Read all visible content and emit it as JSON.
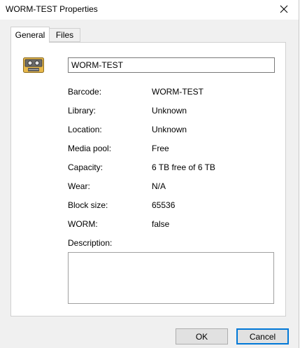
{
  "window": {
    "title": "WORM-TEST Properties"
  },
  "tabs": [
    {
      "label": "General",
      "selected": true
    },
    {
      "label": "Files",
      "selected": false
    }
  ],
  "general": {
    "icon": "tape-cartridge-icon",
    "name_value": "WORM-TEST",
    "properties": [
      {
        "label": "Barcode:",
        "value": "WORM-TEST"
      },
      {
        "label": "Library:",
        "value": "Unknown"
      },
      {
        "label": "Location:",
        "value": "Unknown"
      },
      {
        "label": "Media pool:",
        "value": "Free"
      },
      {
        "label": "Capacity:",
        "value": "6 TB free of 6 TB"
      },
      {
        "label": "Wear:",
        "value": "N/A"
      },
      {
        "label": "Block size:",
        "value": "65536"
      },
      {
        "label": "WORM:",
        "value": "false"
      }
    ],
    "description_label": "Description:",
    "description_value": ""
  },
  "buttons": {
    "ok": "OK",
    "cancel": "Cancel"
  },
  "colors": {
    "accent": "#0078d7",
    "tape_icon": "#e8b84a"
  }
}
